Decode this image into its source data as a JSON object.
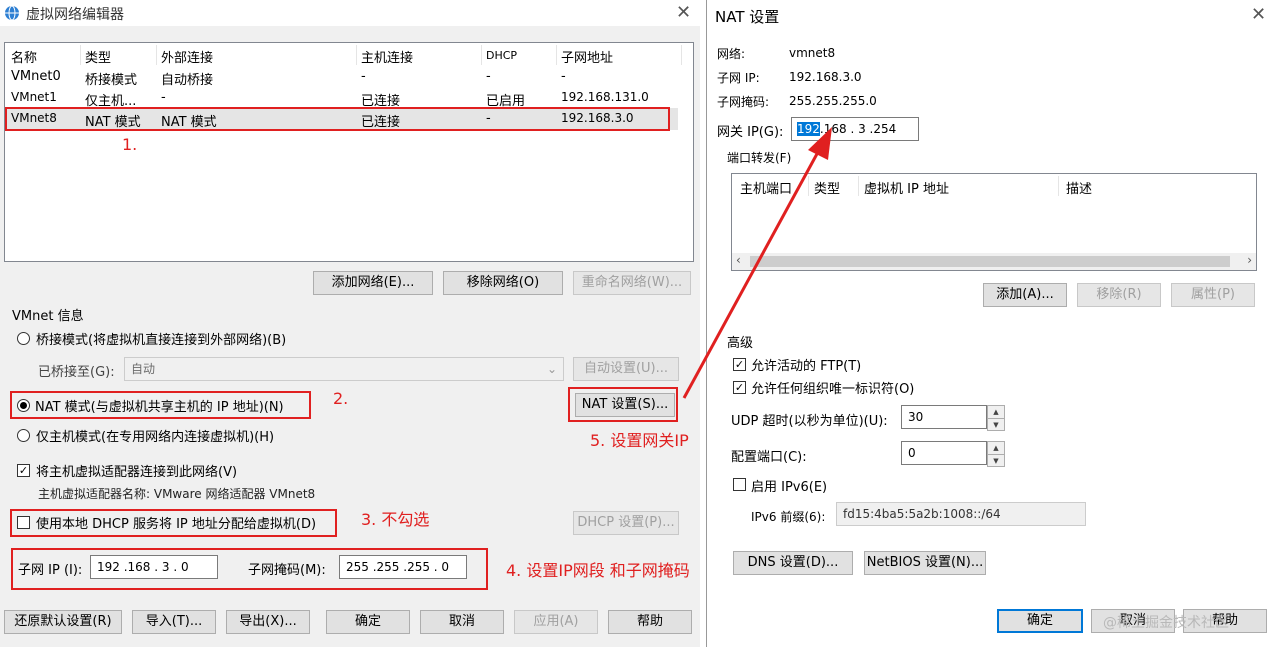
{
  "left": {
    "title": "虚拟网络编辑器",
    "table": {
      "headers": [
        "名称",
        "类型",
        "外部连接",
        "主机连接",
        "DHCP",
        "子网地址"
      ],
      "rows": [
        [
          "VMnet0",
          "桥接模式",
          "自动桥接",
          "-",
          "-",
          "-"
        ],
        [
          "VMnet1",
          "仅主机...",
          "-",
          "已连接",
          "已启用",
          "192.168.131.0"
        ],
        [
          "VMnet8",
          "NAT 模式",
          "NAT 模式",
          "已连接",
          "-",
          "192.168.3.0"
        ]
      ]
    },
    "buttons": {
      "add_network": "添加网络(E)...",
      "remove_network": "移除网络(O)",
      "rename_network": "重命名网络(W)..."
    },
    "vmnet_info": {
      "label": "VMnet 信息",
      "bridged_label": "桥接模式(将虚拟机直接连接到外部网络)(B)",
      "bridged_to_label": "已桥接至(G):",
      "bridged_to_value": "自动",
      "auto_settings": "自动设置(U)...",
      "nat_label": "NAT 模式(与虚拟机共享主机的 IP 地址)(N)",
      "nat_settings": "NAT 设置(S)...",
      "hostonly_label": "仅主机模式(在专用网络内连接虚拟机)(H)",
      "connect_adapter_label": "将主机虚拟适配器连接到此网络(V)",
      "adapter_name_label": "主机虚拟适配器名称: VMware 网络适配器 VMnet8",
      "dhcp_label": "使用本地 DHCP 服务将 IP 地址分配给虚拟机(D)",
      "dhcp_settings": "DHCP 设置(P)...",
      "subnet_ip_label": "子网 IP (I):",
      "subnet_ip_value": "192 .168 . 3 . 0",
      "subnet_mask_label": "子网掩码(M):",
      "subnet_mask_value": "255 .255 .255 . 0"
    },
    "bottom": {
      "restore": "还原默认设置(R)",
      "import": "导入(T)...",
      "export": "导出(X)...",
      "ok": "确定",
      "cancel": "取消",
      "apply": "应用(A)",
      "help": "帮助"
    }
  },
  "right": {
    "title": "NAT 设置",
    "network_label": "网络:",
    "network_value": "vmnet8",
    "subnet_ip_label": "子网 IP:",
    "subnet_ip_value": "192.168.3.0",
    "subnet_mask_label": "子网掩码:",
    "subnet_mask_value": "255.255.255.0",
    "gateway_label": "网关 IP(G):",
    "gateway_sel": "192",
    "gateway_rest": ".168 . 3 .254",
    "port_forward_label": "端口转发(F)",
    "pf_headers": [
      "主机端口",
      "类型",
      "虚拟机 IP 地址",
      "描述"
    ],
    "pf_add": "添加(A)...",
    "pf_remove": "移除(R)",
    "pf_props": "属性(P)",
    "advanced_label": "高级",
    "allow_ftp": "允许活动的 FTP(T)",
    "allow_oui": "允许任何组织唯一标识符(O)",
    "udp_timeout_label": "UDP 超时(以秒为单位)(U):",
    "udp_timeout_value": "30",
    "config_port_label": "配置端口(C):",
    "config_port_value": "0",
    "enable_ipv6": "启用 IPv6(E)",
    "ipv6_prefix_label": "IPv6 前缀(6):",
    "ipv6_prefix_value": "fd15:4ba5:5a2b:1008::/64",
    "dns_settings": "DNS 设置(D)...",
    "netbios_settings": "NetBIOS 设置(N)...",
    "ok": "确定",
    "cancel": "取消",
    "help": "帮助",
    "watermark": "@稀土掘金技术社区"
  },
  "annotations": {
    "n1": "1.",
    "n2": "2.",
    "n3": "3. 不勾选",
    "n4": "4. 设置IP网段 和子网掩码",
    "n5": "5. 设置网关IP"
  },
  "colors": {
    "annotation": "#e02020",
    "accent": "#0078d7"
  }
}
